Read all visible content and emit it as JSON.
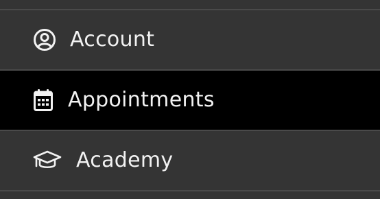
{
  "menu": {
    "items": [
      {
        "label": "Account",
        "icon": "user-circle-icon",
        "active": false
      },
      {
        "label": "Appointments",
        "icon": "calendar-icon",
        "active": true
      },
      {
        "label": "Academy",
        "icon": "graduation-cap-icon",
        "active": false
      }
    ]
  },
  "colors": {
    "background": "#343434",
    "active_background": "#000000",
    "divider": "#4a4a4a",
    "text": "#f2f2f2"
  }
}
